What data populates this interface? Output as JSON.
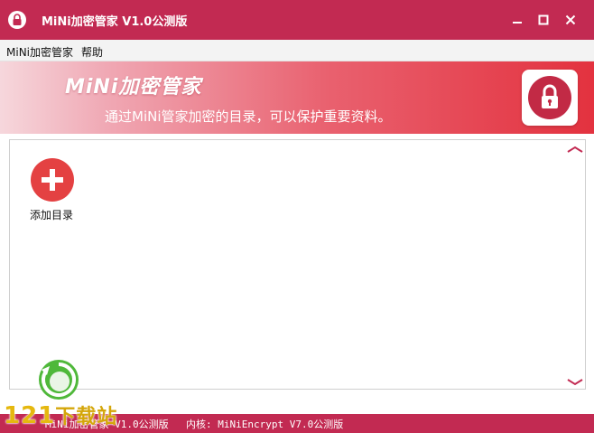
{
  "window": {
    "title": "MiNi加密管家 V1.0公测版",
    "controls": {
      "minimize": "minimize-icon",
      "maximize": "maximize-icon",
      "close": "close-icon"
    }
  },
  "menu": {
    "items": [
      {
        "label": "MiNi加密管家"
      },
      {
        "label": "帮助"
      }
    ]
  },
  "banner": {
    "title": "MiNi加密管家",
    "subtitle": "通过MiNi管家加密的目录，可以保护重要资料。",
    "icon": "lock-icon"
  },
  "content": {
    "add_button": {
      "label": "添加目录",
      "icon": "plus-icon"
    },
    "scroll_up_icon": "chevron-up-icon",
    "scroll_down_icon": "chevron-down-icon"
  },
  "status": {
    "left": "MiNi加密管家 V1.0公测版",
    "right": "内核: MiNiEncrypt V7.0公测版"
  },
  "watermark": {
    "text_num": "121",
    "text_cn": "下载站"
  },
  "colors": {
    "brand": "#c22a52",
    "banner_end": "#e3323f",
    "add_button": "#e44142",
    "watermark": "#e5b80f"
  }
}
